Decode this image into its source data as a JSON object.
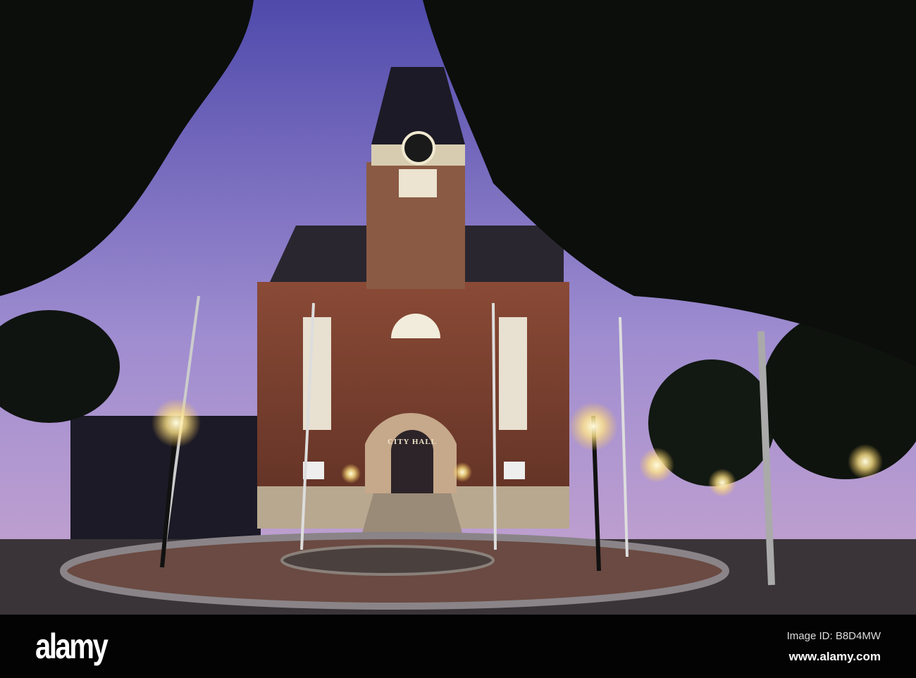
{
  "photo": {
    "subject": "City hall clock tower at dusk",
    "building_sign": "CITY HALL",
    "colors": {
      "sky_top": "#5a53b8",
      "sky_bottom": "#b89ad0",
      "brick": "#7a3a2c",
      "lamp": "#fff4c0"
    }
  },
  "footer": {
    "logo": "alamy",
    "image_id": "Image ID: B8D4MW",
    "website": "www.alamy.com"
  }
}
